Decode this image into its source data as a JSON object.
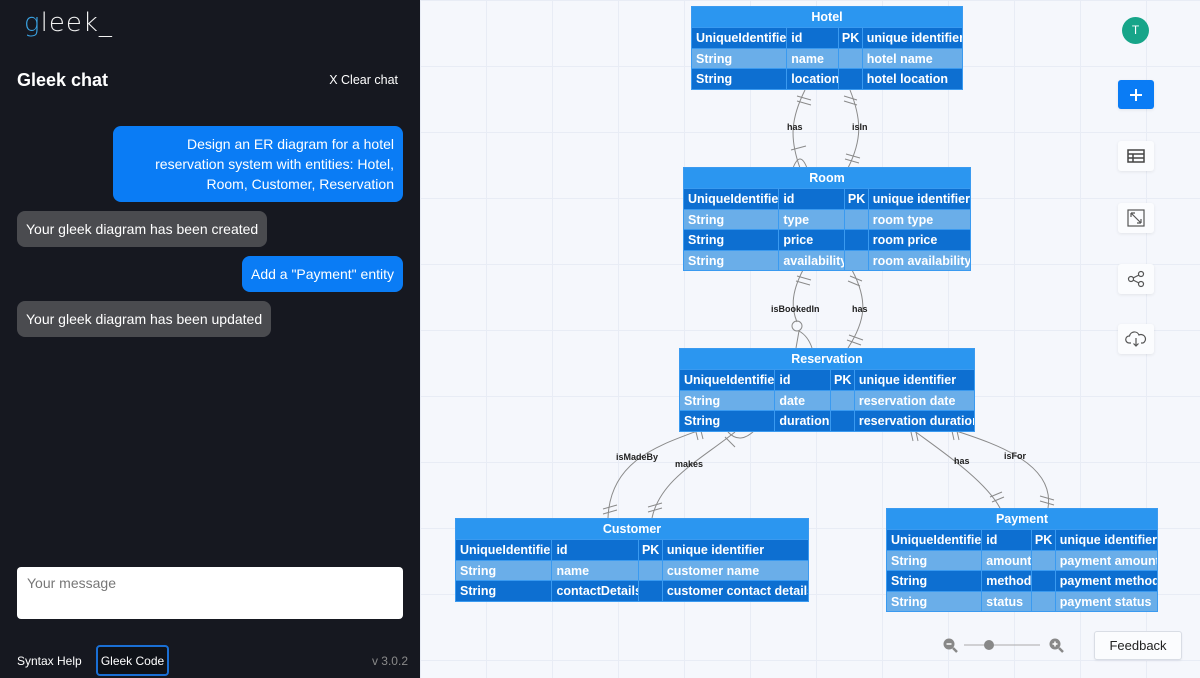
{
  "sidebar": {
    "logo": {
      "first": "g",
      "rest": "leek_"
    },
    "title": "Gleek chat",
    "clear_chat": "X Clear chat",
    "messages": [
      {
        "role": "user",
        "text": "Design an ER diagram for a hotel reservation system with entities: Hotel, Room, Customer, Reservation"
      },
      {
        "role": "bot",
        "text": "Your gleek diagram has been created"
      },
      {
        "role": "user",
        "text": "Add a \"Payment\" entity"
      },
      {
        "role": "bot",
        "text": "Your gleek diagram has been updated"
      }
    ],
    "input_placeholder": "Your message",
    "syntax_help": "Syntax Help",
    "gleek_code": "Gleek Code",
    "version": "v 3.0.2"
  },
  "diagram": {
    "entities": {
      "hotel": {
        "name": "Hotel",
        "rows": [
          [
            "UniqueIdentifier",
            "id",
            "PK",
            "unique identifier"
          ],
          [
            "String",
            "name",
            "",
            "hotel name"
          ],
          [
            "String",
            "location",
            "",
            "hotel location"
          ]
        ]
      },
      "room": {
        "name": "Room",
        "rows": [
          [
            "UniqueIdentifier",
            "id",
            "PK",
            "unique identifier"
          ],
          [
            "String",
            "type",
            "",
            "room type"
          ],
          [
            "String",
            "price",
            "",
            "room price"
          ],
          [
            "String",
            "availability",
            "",
            "room availability"
          ]
        ]
      },
      "reservation": {
        "name": "Reservation",
        "rows": [
          [
            "UniqueIdentifier",
            "id",
            "PK",
            "unique identifier"
          ],
          [
            "String",
            "date",
            "",
            "reservation date"
          ],
          [
            "String",
            "duration",
            "",
            "reservation duration"
          ]
        ]
      },
      "customer": {
        "name": "Customer",
        "rows": [
          [
            "UniqueIdentifier",
            "id",
            "PK",
            "unique identifier"
          ],
          [
            "String",
            "name",
            "",
            "customer name"
          ],
          [
            "String",
            "contactDetails",
            "",
            "customer contact details"
          ]
        ]
      },
      "payment": {
        "name": "Payment",
        "rows": [
          [
            "UniqueIdentifier",
            "id",
            "PK",
            "unique identifier"
          ],
          [
            "String",
            "amount",
            "",
            "payment amount"
          ],
          [
            "String",
            "method",
            "",
            "payment method"
          ],
          [
            "String",
            "status",
            "",
            "payment status"
          ]
        ]
      }
    },
    "relationships": [
      {
        "label": "has",
        "from": "Hotel",
        "to": "Room"
      },
      {
        "label": "isIn",
        "from": "Room",
        "to": "Hotel"
      },
      {
        "label": "isBookedIn",
        "from": "Room",
        "to": "Reservation"
      },
      {
        "label": "has",
        "from": "Room",
        "to": "Reservation"
      },
      {
        "label": "isMadeBy",
        "from": "Reservation",
        "to": "Customer"
      },
      {
        "label": "makes",
        "from": "Customer",
        "to": "Reservation"
      },
      {
        "label": "has",
        "from": "Reservation",
        "to": "Payment"
      },
      {
        "label": "isFor",
        "from": "Payment",
        "to": "Reservation"
      }
    ]
  },
  "toolbar": {
    "avatar_initial": "T",
    "feedback": "Feedback",
    "zoom_level": 0.25
  }
}
